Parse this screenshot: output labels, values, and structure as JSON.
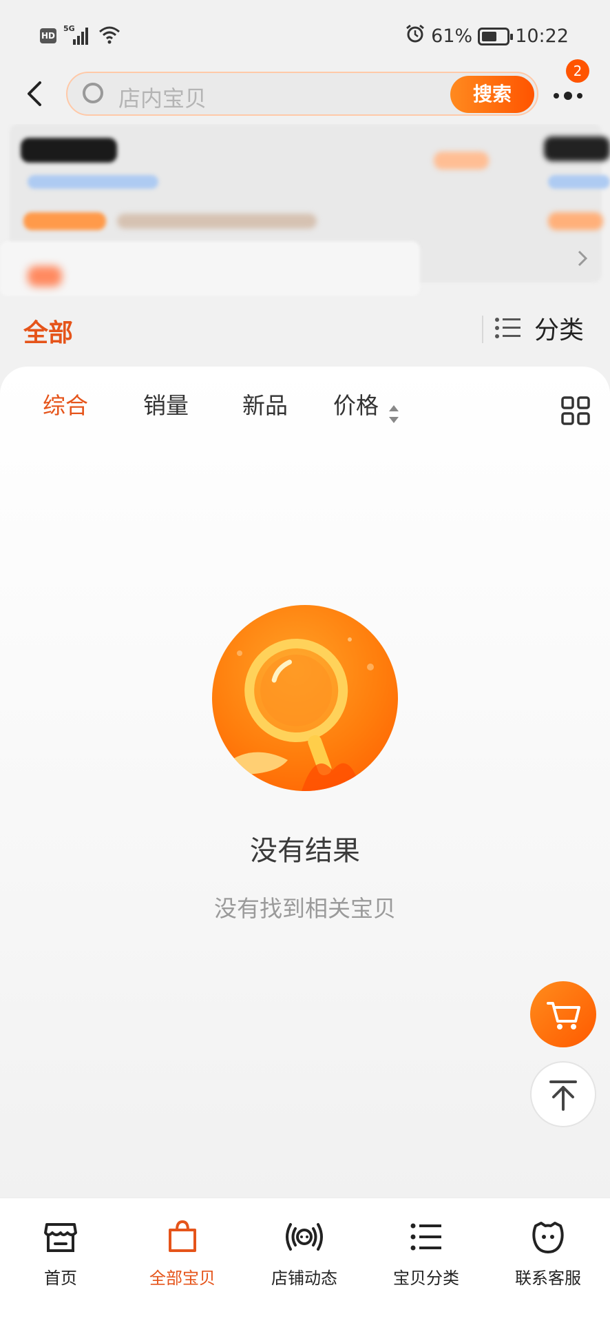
{
  "status_bar": {
    "hd": "HD",
    "network": "5G",
    "battery_percent": "61%",
    "battery_level": 0.61,
    "time": "10:22"
  },
  "header": {
    "search_placeholder": "店内宝贝",
    "search_button": "搜索",
    "more_badge_count": "2"
  },
  "shop_tabs": {
    "all_label": "全部",
    "category_label": "分类"
  },
  "sort_bar": {
    "items": [
      "综合",
      "销量",
      "新品",
      "价格"
    ],
    "active_index": 0
  },
  "empty_state": {
    "title": "没有结果",
    "subtitle": "没有找到相关宝贝"
  },
  "bottom_nav": {
    "items": [
      {
        "label": "首页",
        "icon": "shop-front-icon"
      },
      {
        "label": "全部宝贝",
        "icon": "shopping-bag-icon"
      },
      {
        "label": "店铺动态",
        "icon": "broadcast-icon"
      },
      {
        "label": "宝贝分类",
        "icon": "list-icon"
      },
      {
        "label": "联系客服",
        "icon": "customer-service-icon"
      }
    ],
    "active_index": 1
  },
  "colors": {
    "accent": "#e5541a",
    "button_gradient_start": "#ff8a1f",
    "button_gradient_end": "#ff5400"
  }
}
